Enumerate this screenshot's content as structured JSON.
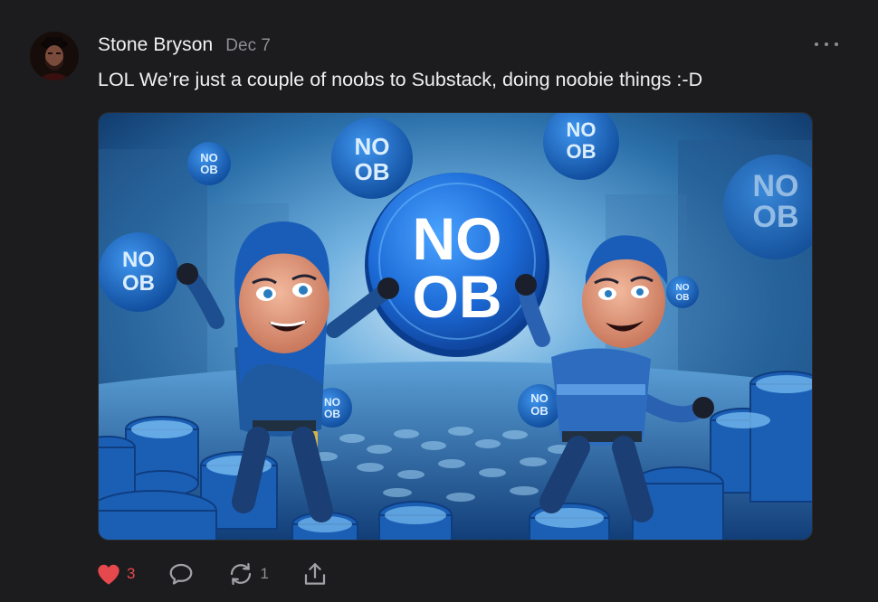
{
  "post": {
    "author": "Stone Bryson",
    "date": "Dec 7",
    "text": "LOL We’re just a couple of noobs to Substack, doing noobie things :-D",
    "image": {
      "big_coin_line1": "NO",
      "big_coin_line2": "OB",
      "coin_label_line1": "NO",
      "coin_label_line2": "OB"
    },
    "actions": {
      "like_count": "3",
      "comment_count": "",
      "restack_count": "1"
    },
    "icons": {
      "like": "heart-icon",
      "comment": "speech-bubble-icon",
      "restack": "restack-arrows-icon",
      "share": "share-upload-icon",
      "more": "ellipsis-icon"
    },
    "colors": {
      "like": "#e5484d",
      "muted": "#8e8e93",
      "background": "#1c1c1e",
      "coin_blue": "#1e6fd9"
    }
  }
}
